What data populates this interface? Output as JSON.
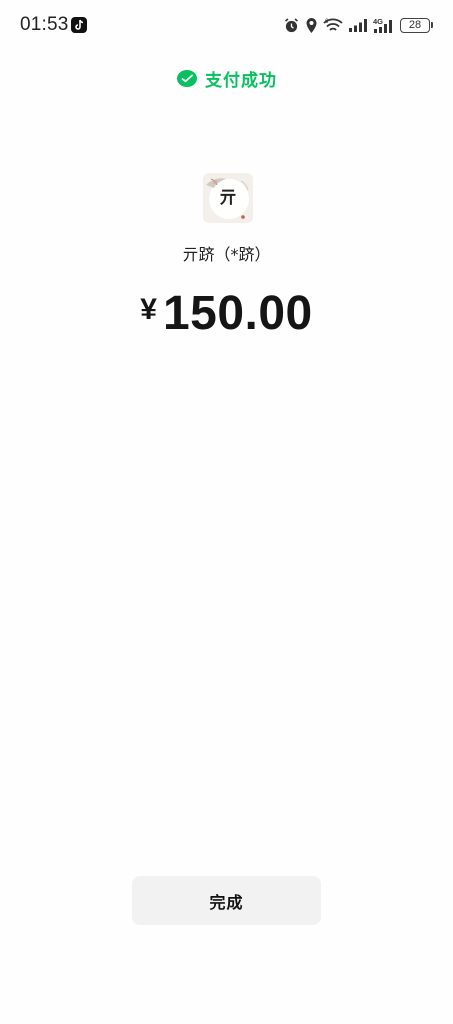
{
  "status_bar": {
    "time": "01:53",
    "battery": "28",
    "network_label": "4G",
    "icons": [
      "tiktok-icon",
      "alarm-icon",
      "location-icon",
      "wifi-icon",
      "signal-icon",
      "signal-4g-icon",
      "battery-icon"
    ]
  },
  "header": {
    "title": "支付成功",
    "icon": "wechat-pay-icon",
    "accent_color": "#07c160"
  },
  "payee": {
    "avatar_char": "亓",
    "name": "亓跻（*跻）"
  },
  "payment": {
    "currency": "¥",
    "amount": "150.00"
  },
  "footer": {
    "done_label": "完成"
  }
}
